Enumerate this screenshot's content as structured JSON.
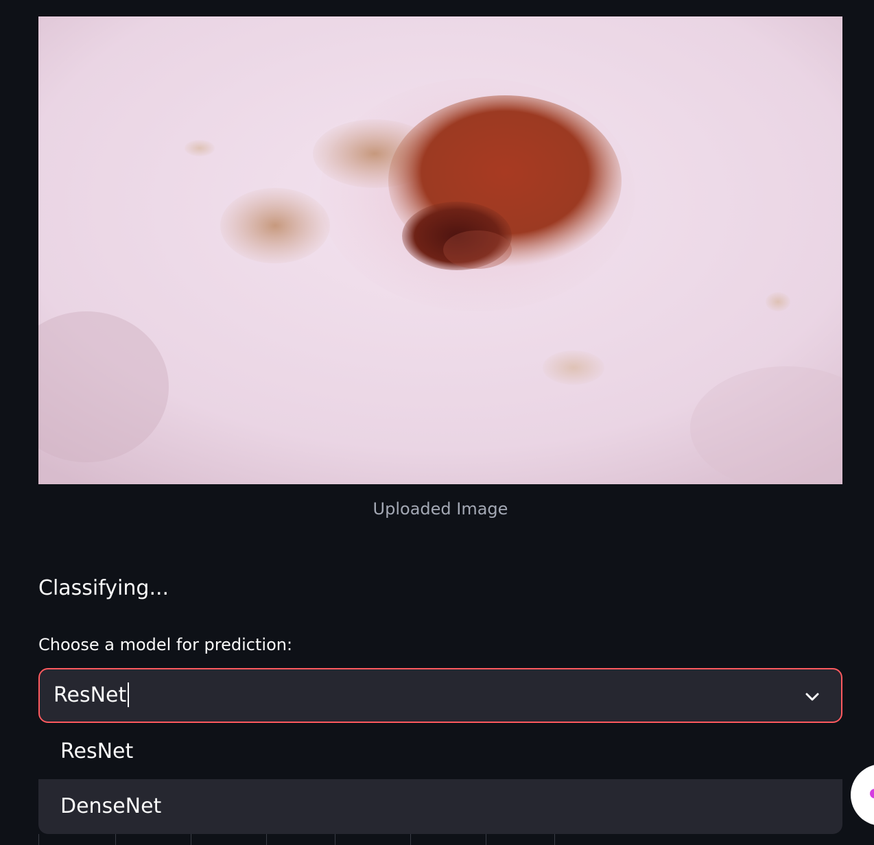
{
  "image": {
    "caption": "Uploaded Image"
  },
  "status": {
    "text": "Classifying..."
  },
  "model_select": {
    "label": "Choose a model for prediction:",
    "value": "ResNet",
    "icon": "chevron-down-icon",
    "options": [
      {
        "label": "ResNet"
      },
      {
        "label": "DenseNet"
      }
    ]
  },
  "colors": {
    "background": "#0e1117",
    "input_background": "#262730",
    "focus_border": "#ff5a5f",
    "caption": "#a3a8b4"
  }
}
